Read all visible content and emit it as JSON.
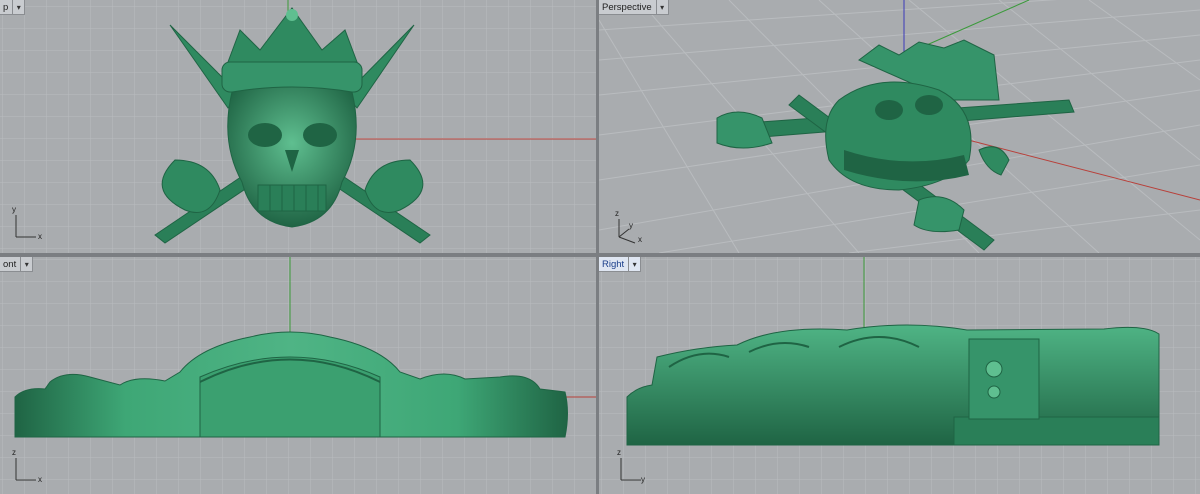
{
  "viewports": {
    "top": {
      "label": "Top",
      "visible_label": "p",
      "axes": [
        "x",
        "y"
      ]
    },
    "perspective": {
      "label": "Perspective",
      "axes": [
        "x",
        "y",
        "z"
      ]
    },
    "front": {
      "label": "Front",
      "visible_label": "ont",
      "axes": [
        "x",
        "z"
      ]
    },
    "right": {
      "label": "Right",
      "axes": [
        "y",
        "z"
      ],
      "active": true
    }
  },
  "dropdown_icon": "chevron-down-icon",
  "colors": {
    "viewport_bg": "#a9acaf",
    "grid": "#b9bcbf",
    "grid_major": "#9da0a3",
    "x_axis": "#b8403a",
    "y_axis": "#3a9a3a",
    "z_axis": "#3a3ab8",
    "model": "#2f8a60",
    "model_dark": "#1f6444",
    "model_light": "#5fbf90"
  }
}
